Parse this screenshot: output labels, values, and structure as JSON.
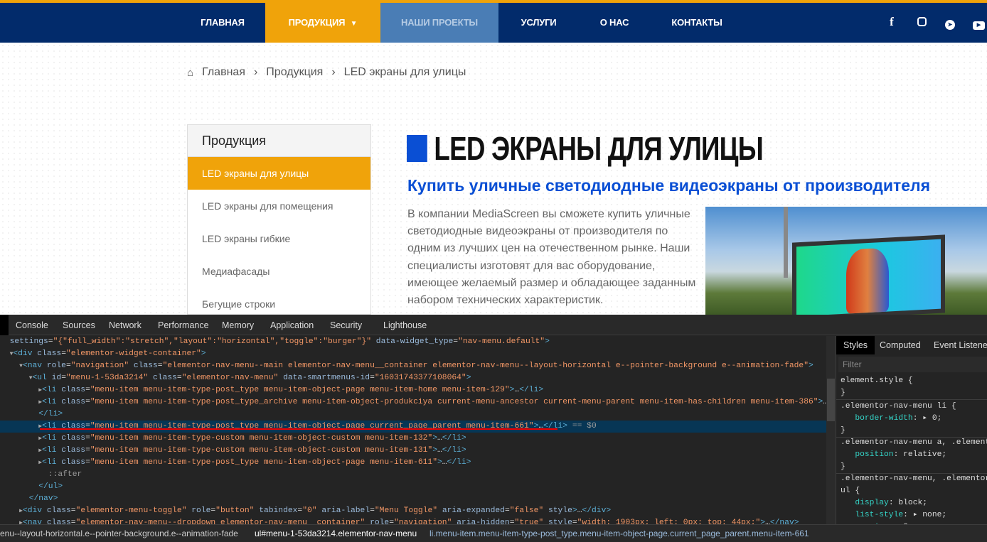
{
  "nav": {
    "items": [
      "ГЛАВНАЯ",
      "ПРОДУКЦИЯ",
      "НАШИ ПРОЕКТЫ",
      "УСЛУГИ",
      "О НАС",
      "КОНТАКТЫ"
    ],
    "dropdown_icon": "▼",
    "social": [
      "facebook-icon",
      "instagram-icon",
      "telegram-icon",
      "youtube-icon"
    ]
  },
  "breadcrumb": {
    "items": [
      "Главная",
      "Продукция",
      "LED экраны для улицы"
    ],
    "sep": "›"
  },
  "sidebar": {
    "title": "Продукция",
    "items": [
      "LED экраны для улицы",
      "LED экраны для помещения",
      "LED экраны гибкие",
      "Медиафасады",
      "Бегущие строки"
    ]
  },
  "main": {
    "title": "LED ЭКРАНЫ ДЛЯ УЛИЦЫ",
    "subtitle": "Купить уличные светодиодные видеоэкраны от производителя",
    "paragraph": "В компании MediaScreen вы сможете купить уличные светодиодные видеоэкраны от производителя по одним из лучших цен на отечественном рынке. Наши специалисты изготовят для вас оборудование, имеющее желаемый размер и обладающее заданным набором технических характеристик."
  },
  "devtools": {
    "tabs": [
      "Console",
      "Sources",
      "Network",
      "Performance",
      "Memory",
      "Application",
      "Security",
      "Lighthouse"
    ],
    "style_tabs": [
      "Styles",
      "Computed",
      "Event Listeners"
    ],
    "filter_placeholder": "Filter",
    "breadcrumbs": [
      "enu--layout-horizontal.e--pointer-background.e--animation-fade",
      "ul#menu-1-53da3214.elementor-nav-menu",
      "li.menu-item.menu-item-type-post_type.menu-item-object-page.current_page_parent.menu-item-661"
    ],
    "selected_marker": "== $0",
    "accent": "#073655"
  },
  "colors": {
    "nav_bg": "#022b6b",
    "orange": "#f0a30a",
    "blue_tab": "#4a7db5",
    "title_blue": "#0a4fd4"
  }
}
